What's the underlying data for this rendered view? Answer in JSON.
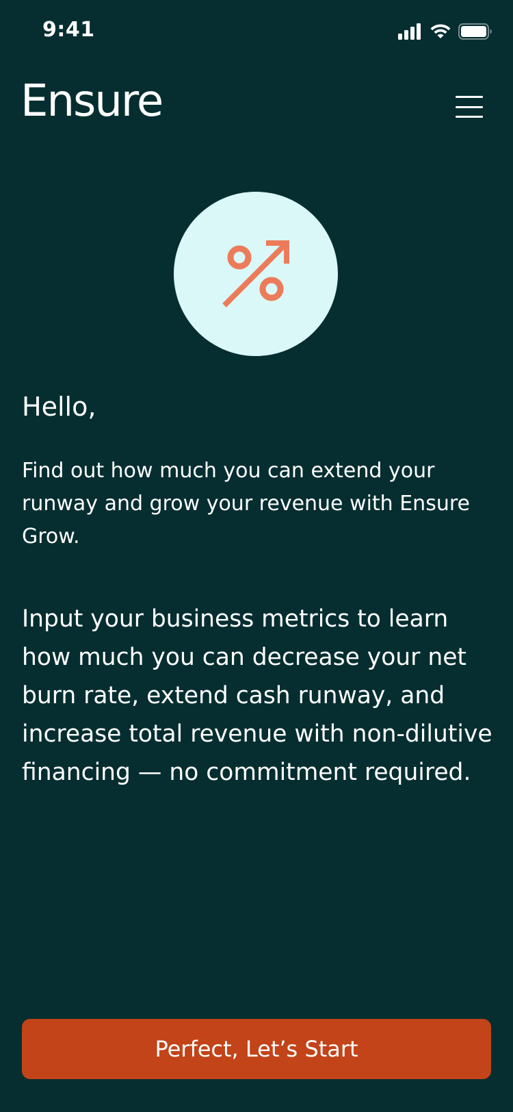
{
  "status_bar": {
    "time": "9:41",
    "icons": [
      "cellular-signal-icon",
      "wifi-icon",
      "battery-icon"
    ]
  },
  "header": {
    "logo_text": "Ensure",
    "menu_icon": "hamburger-menu-icon"
  },
  "hero": {
    "icon": "percent-growth-arrow-icon",
    "circle_color": "#D9F8F7",
    "icon_color": "#EC7B5A"
  },
  "content": {
    "greeting": "Hello,",
    "intro": "Find out how much you can extend your runway and grow your revenue with Ensure Grow.",
    "body": "Input your business metrics to learn how much you can decrease your net burn rate, extend cash runway, and increase total revenue with non-dilutive financing — no commitment required."
  },
  "cta": {
    "label": "Perfect, Let’s Start",
    "color": "#C24418"
  },
  "colors": {
    "background": "#062E30",
    "text": "#FFFFFF"
  }
}
